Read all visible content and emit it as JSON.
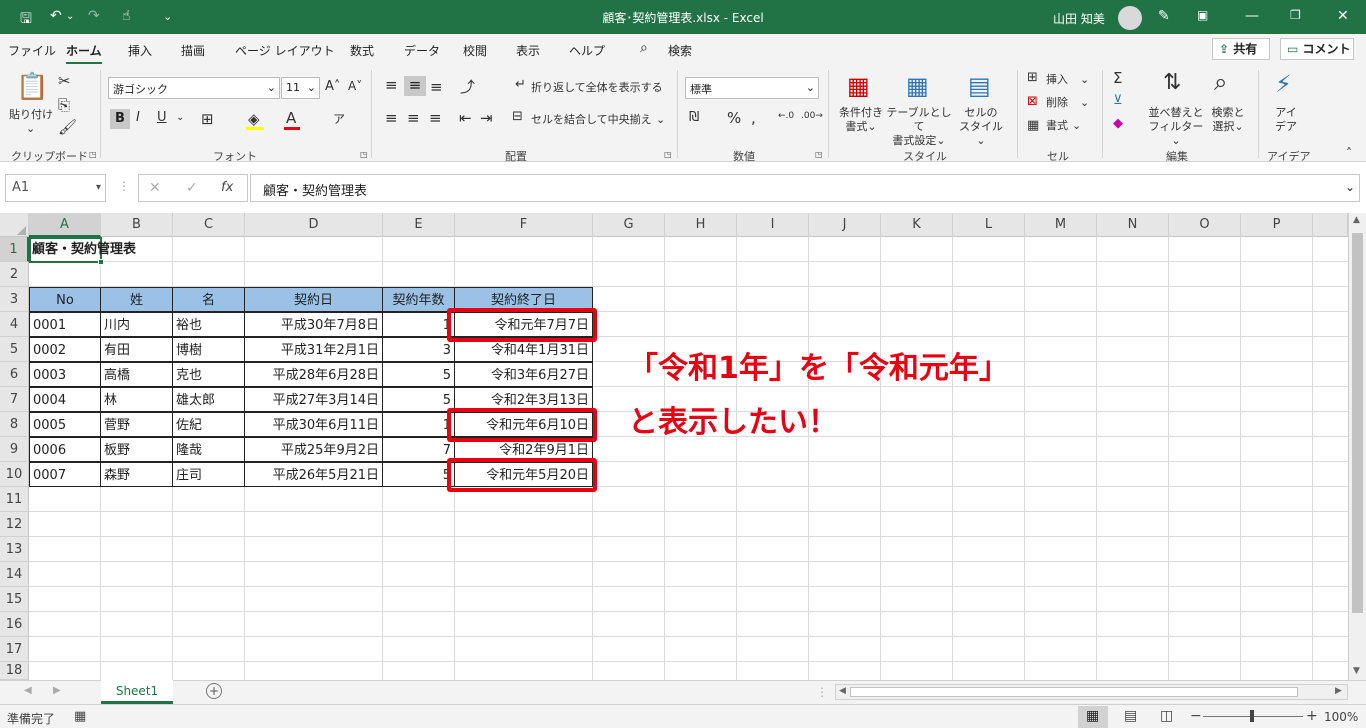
{
  "window": {
    "title": "顧客･契約管理表.xlsx  -  Excel",
    "user": "山田 知美"
  },
  "menu": [
    "ファイル",
    "ホーム",
    "挿入",
    "描画",
    "ページ レイアウト",
    "数式",
    "データ",
    "校閲",
    "表示",
    "ヘルプ"
  ],
  "search_label": "検索",
  "share_label": "共有",
  "comment_label": "コメント",
  "ribbon": {
    "paste": "貼り付け",
    "clipboard": "クリップボード",
    "font_name": "游ゴシック",
    "font_size": "11",
    "font": "フォント",
    "wrap": "折り返して全体を表示する",
    "merge": "セルを結合して中央揃え",
    "alignment": "配置",
    "number_format": "標準",
    "number": "数値",
    "cond_format": [
      "条件付き",
      "書式"
    ],
    "table_format": [
      "テーブルとして",
      "書式設定"
    ],
    "cell_style": [
      "セルの",
      "スタイル"
    ],
    "style": "スタイル",
    "insert": "挿入",
    "delete": "削除",
    "format": "書式",
    "cells": "セル",
    "sort": [
      "並べ替えと",
      "フィルター"
    ],
    "find": [
      "検索と",
      "選択"
    ],
    "editing": "編集",
    "ideas": [
      "アイ",
      "デア"
    ],
    "ideas_group": "アイデア"
  },
  "formula_bar": {
    "name_box": "A1",
    "content": "顧客・契約管理表"
  },
  "columns": [
    "A",
    "B",
    "C",
    "D",
    "E",
    "F",
    "G",
    "H",
    "I",
    "J",
    "K",
    "L",
    "M",
    "N",
    "O",
    "P"
  ],
  "rows": [
    "1",
    "2",
    "3",
    "4",
    "5",
    "6",
    "7",
    "8",
    "9",
    "10",
    "11",
    "12",
    "13",
    "14",
    "15",
    "16",
    "17",
    "18"
  ],
  "sheet": {
    "title": "顧客・契約管理表",
    "headers": [
      "No",
      "姓",
      "名",
      "契約日",
      "契約年数",
      "契約終了日"
    ],
    "data": [
      [
        "0001",
        "川内",
        "裕也",
        "平成30年7月8日",
        "1",
        "令和元年7月7日"
      ],
      [
        "0002",
        "有田",
        "博樹",
        "平成31年2月1日",
        "3",
        "令和4年1月31日"
      ],
      [
        "0003",
        "高橋",
        "克也",
        "平成28年6月28日",
        "5",
        "令和3年6月27日"
      ],
      [
        "0004",
        "林",
        "雄太郎",
        "平成27年3月14日",
        "5",
        "令和2年3月13日"
      ],
      [
        "0005",
        "菅野",
        "佐紀",
        "平成30年6月11日",
        "1",
        "令和元年6月10日"
      ],
      [
        "0006",
        "板野",
        "隆哉",
        "平成25年9月2日",
        "7",
        "令和2年9月1日"
      ],
      [
        "0007",
        "森野",
        "庄司",
        "平成26年5月21日",
        "5",
        "令和元年5月20日"
      ]
    ]
  },
  "annotation": {
    "line1": "「令和1年」を「令和元年」",
    "line2": "と表示したい！",
    "color": "#e60012"
  },
  "tabs": {
    "sheet1": "Sheet1"
  },
  "status": {
    "ready": "準備完了",
    "zoom": "100%"
  },
  "colors": {
    "excel_green": "#217346",
    "header_fill": "#9bc2e6"
  }
}
